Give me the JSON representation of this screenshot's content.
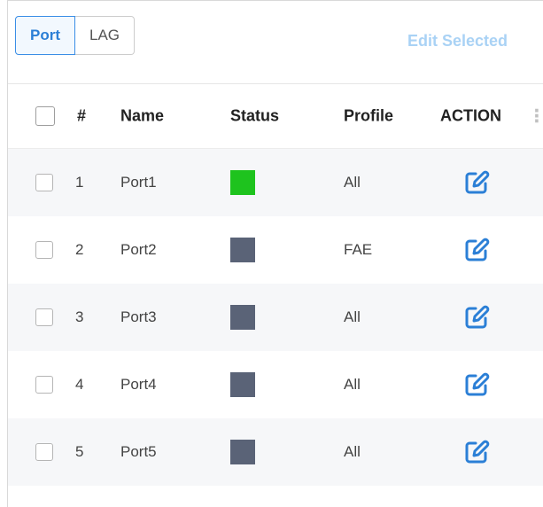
{
  "tabs": [
    {
      "label": "Port",
      "active": true
    },
    {
      "label": "LAG",
      "active": false
    }
  ],
  "edit_selected_label": "Edit Selected",
  "columns": {
    "index": "#",
    "name": "Name",
    "status": "Status",
    "profile": "Profile",
    "action": "ACTION"
  },
  "colors": {
    "accent": "#2b7fd6",
    "status_up": "#1ec31e",
    "status_down": "#5a6377",
    "disabled_text": "#a9d2f5"
  },
  "rows": [
    {
      "index": "1",
      "name": "Port1",
      "status": "up",
      "profile": "All"
    },
    {
      "index": "2",
      "name": "Port2",
      "status": "down",
      "profile": "FAE"
    },
    {
      "index": "3",
      "name": "Port3",
      "status": "down",
      "profile": "All"
    },
    {
      "index": "4",
      "name": "Port4",
      "status": "down",
      "profile": "All"
    },
    {
      "index": "5",
      "name": "Port5",
      "status": "down",
      "profile": "All"
    }
  ]
}
